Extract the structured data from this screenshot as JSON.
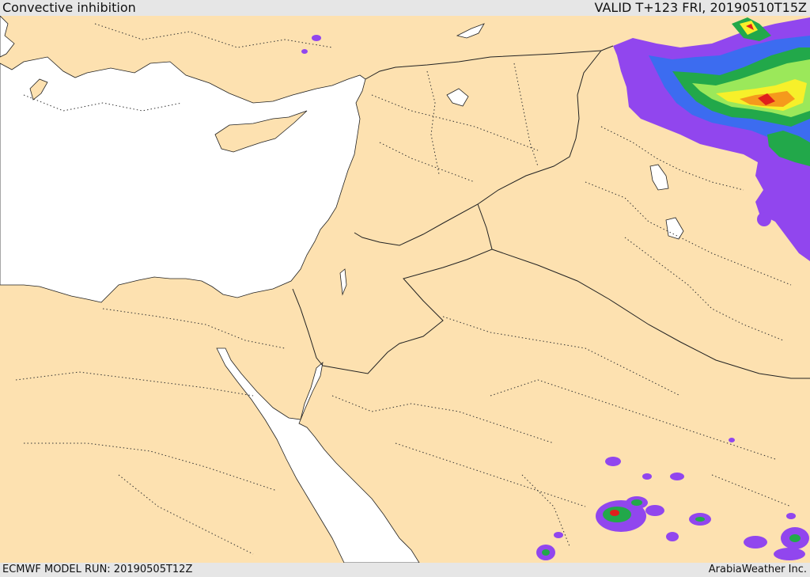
{
  "header": {
    "title": "Convective inhibition",
    "valid": "VALID T+123 FRI, 20190510T15Z"
  },
  "footer": {
    "model_run": "ECMWF MODEL RUN: 20190505T12Z",
    "credit": "ArabiaWeather Inc."
  },
  "colors": {
    "land": "#fde1b0",
    "sea": "#ffffff",
    "border": "#222222",
    "cin_purple": "#9146ee",
    "cin_blue": "#3c6cf0",
    "cin_green": "#22a84a",
    "cin_lightgreen": "#9be85a",
    "cin_yellow": "#f7f02a",
    "cin_orange": "#f59a1c",
    "cin_red": "#e0201c"
  }
}
